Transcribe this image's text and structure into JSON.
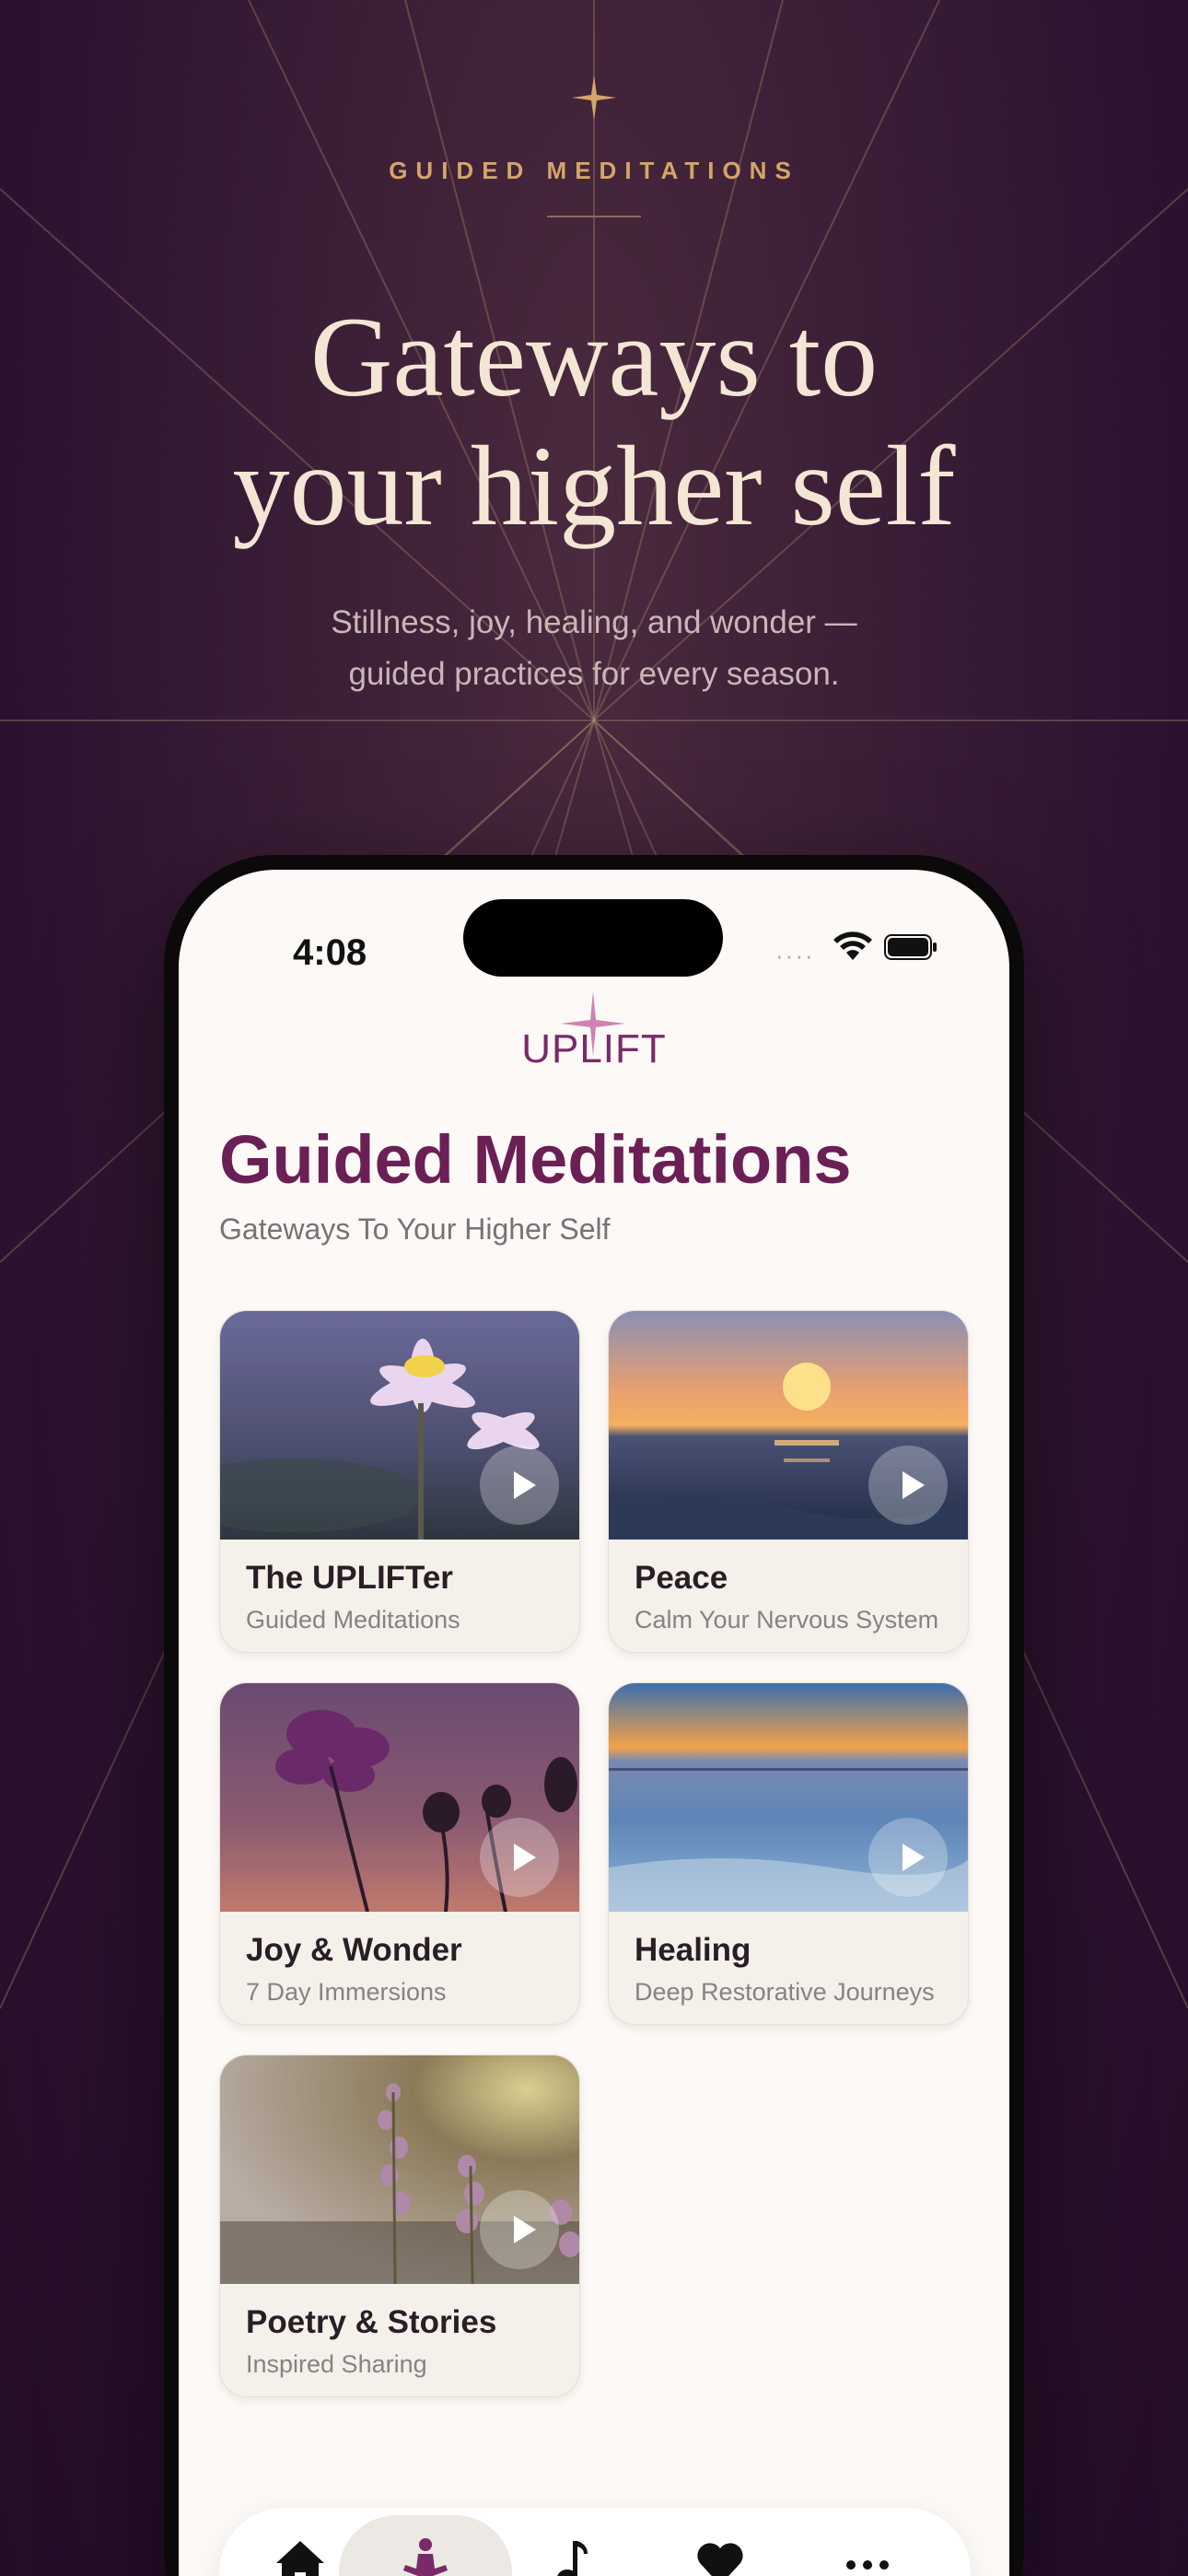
{
  "hero": {
    "eyebrow": "GUIDED MEDITATIONS",
    "headline_line1": "Gateways to",
    "headline_line2": "your higher self",
    "subline_line1": "Stillness, joy, healing, and wonder —",
    "subline_line2": "guided practices for every season."
  },
  "status_bar": {
    "time": "4:08",
    "signal": "····"
  },
  "app": {
    "logo_text": "UPLIFT",
    "title": "Guided Meditations",
    "subtitle": "Gateways To Your Higher Self"
  },
  "cards": [
    {
      "title": "The UPLIFTer",
      "subtitle": "Guided Meditations",
      "image": "water-lily"
    },
    {
      "title": "Peace",
      "subtitle": "Calm Your Nervous System",
      "image": "ocean-sunset"
    },
    {
      "title": "Joy & Wonder",
      "subtitle": "7 Day Immersions",
      "image": "cosmos-flower"
    },
    {
      "title": "Healing",
      "subtitle": "Deep Restorative Journeys",
      "image": "calm-sea"
    },
    {
      "title": "Poetry & Stories",
      "subtitle": "Inspired Sharing",
      "image": "lupine-flowers"
    }
  ],
  "tabbar": {
    "tabs": [
      {
        "icon": "home-icon"
      },
      {
        "icon": "meditation-icon",
        "active": true
      },
      {
        "icon": "music-note-icon"
      },
      {
        "icon": "heart-icon"
      },
      {
        "icon": "more-icon"
      }
    ]
  },
  "colors": {
    "background": "#2c1230",
    "accent_gold": "#d4a56a",
    "brand_purple": "#6a1f55",
    "screen_bg": "#fcf9f6"
  }
}
